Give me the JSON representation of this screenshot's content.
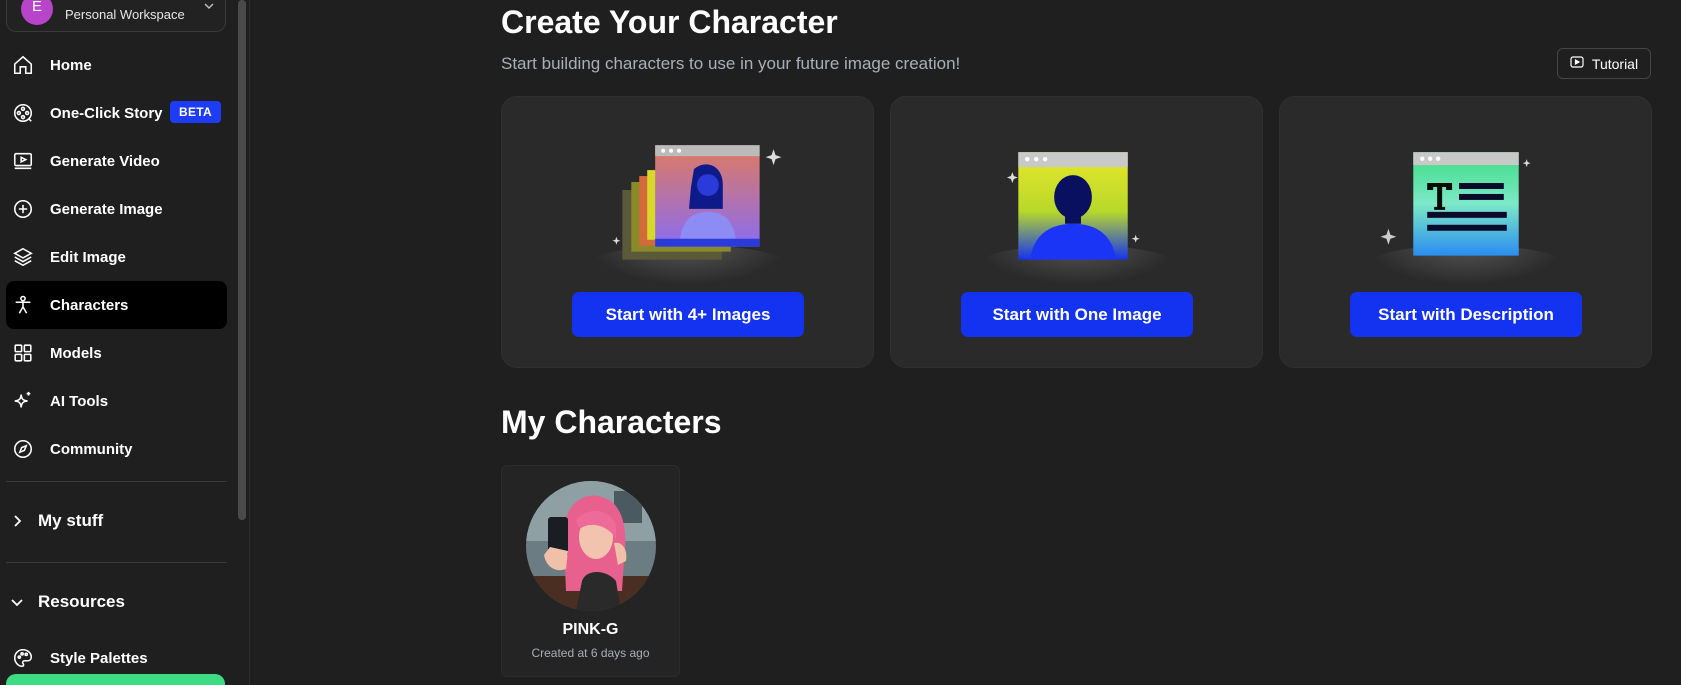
{
  "workspace": {
    "avatar_letter": "E",
    "label": "Personal Workspace"
  },
  "nav": [
    {
      "label": "Home",
      "icon": "home-icon"
    },
    {
      "label": "One-Click Story",
      "icon": "film-reel-icon",
      "badge": "BETA"
    },
    {
      "label": "Generate Video",
      "icon": "video-icon"
    },
    {
      "label": "Generate Image",
      "icon": "plus-circle-icon"
    },
    {
      "label": "Edit Image",
      "icon": "layers-icon"
    },
    {
      "label": "Characters",
      "icon": "person-icon",
      "active": true
    },
    {
      "label": "Models",
      "icon": "grid-icon"
    },
    {
      "label": "AI Tools",
      "icon": "sparkle-icon"
    },
    {
      "label": "Community",
      "icon": "compass-icon"
    }
  ],
  "sections": {
    "my_stuff": "My stuff",
    "resources": "Resources",
    "style_palettes": "Style Palettes"
  },
  "header": {
    "title": "Create Your Character",
    "subtitle": "Start building characters to use in your future image creation!",
    "tutorial_label": "Tutorial"
  },
  "cards": [
    {
      "cta": "Start with 4+ Images"
    },
    {
      "cta": "Start with One Image"
    },
    {
      "cta": "Start with Description"
    }
  ],
  "my_characters": {
    "title": "My Characters",
    "items": [
      {
        "name": "PINK-G",
        "meta": "Created at 6 days ago"
      }
    ]
  },
  "colors": {
    "accent": "#1433f0",
    "beta_badge": "#1d3cf5",
    "background": "#1f1f1f",
    "card": "#2a2a2a",
    "workspace_avatar": "#b744c9"
  }
}
